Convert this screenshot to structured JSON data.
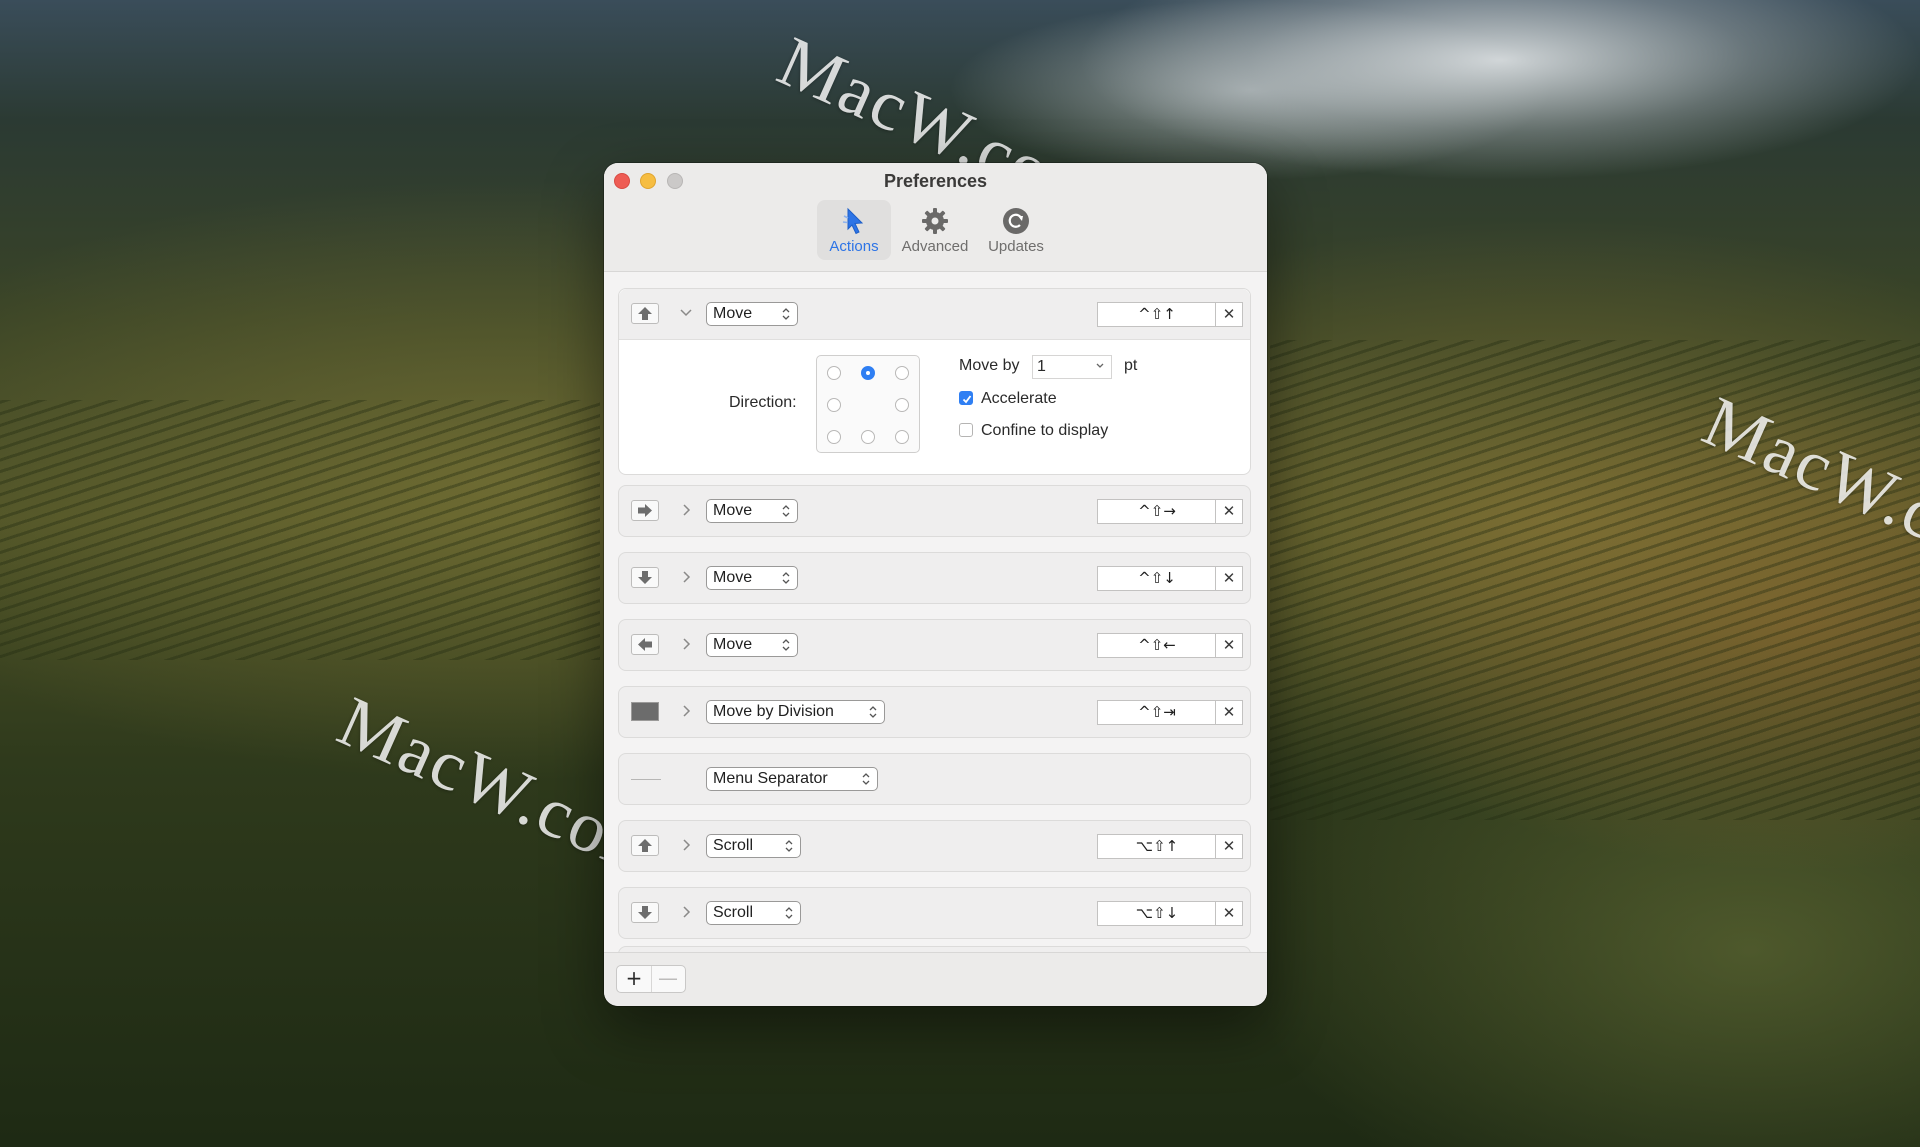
{
  "window": {
    "title": "Preferences"
  },
  "toolbar": [
    {
      "label": "Actions",
      "icon": "cursor-icon",
      "active": true
    },
    {
      "label": "Advanced",
      "icon": "gear-icon",
      "active": false
    },
    {
      "label": "Updates",
      "icon": "refresh-icon",
      "active": false
    }
  ],
  "actions": [
    {
      "icon": "arrow-up-icon",
      "disclosure": "expanded",
      "action": "Move",
      "shortcut": "^⇧↑"
    },
    {
      "icon": "arrow-right-icon",
      "disclosure": "collapsed",
      "action": "Move",
      "shortcut": "^⇧→"
    },
    {
      "icon": "arrow-down-icon",
      "disclosure": "collapsed",
      "action": "Move",
      "shortcut": "^⇧↓"
    },
    {
      "icon": "arrow-left-icon",
      "disclosure": "collapsed",
      "action": "Move",
      "shortcut": "^⇧←"
    },
    {
      "icon": "division-icon",
      "disclosure": "collapsed",
      "action": "Move by Division",
      "shortcut": "^⇧⇥"
    },
    {
      "icon": "separator-icon",
      "disclosure": "none",
      "action": "Menu Separator",
      "shortcut": ""
    },
    {
      "icon": "arrow-up-icon",
      "disclosure": "collapsed",
      "action": "Scroll",
      "shortcut": "⌥⇧↑"
    },
    {
      "icon": "arrow-down-icon",
      "disclosure": "collapsed",
      "action": "Scroll",
      "shortcut": "⌥⇧↓"
    }
  ],
  "move_options": {
    "direction_label": "Direction:",
    "selected_direction": "up",
    "move_by_label": "Move by",
    "move_by_value": "1",
    "unit": "pt",
    "accelerate_label": "Accelerate",
    "accelerate_checked": true,
    "confine_label": "Confine to display",
    "confine_checked": false
  },
  "footer": {
    "add_symbol": "+",
    "remove_symbol": "—"
  },
  "desktop": {
    "watermark": "MacW.com"
  },
  "colors": {
    "accent": "#2f7ff3",
    "close": "#ee5c54",
    "minimize": "#f6bd41",
    "zoom": "#cbc9c8"
  }
}
